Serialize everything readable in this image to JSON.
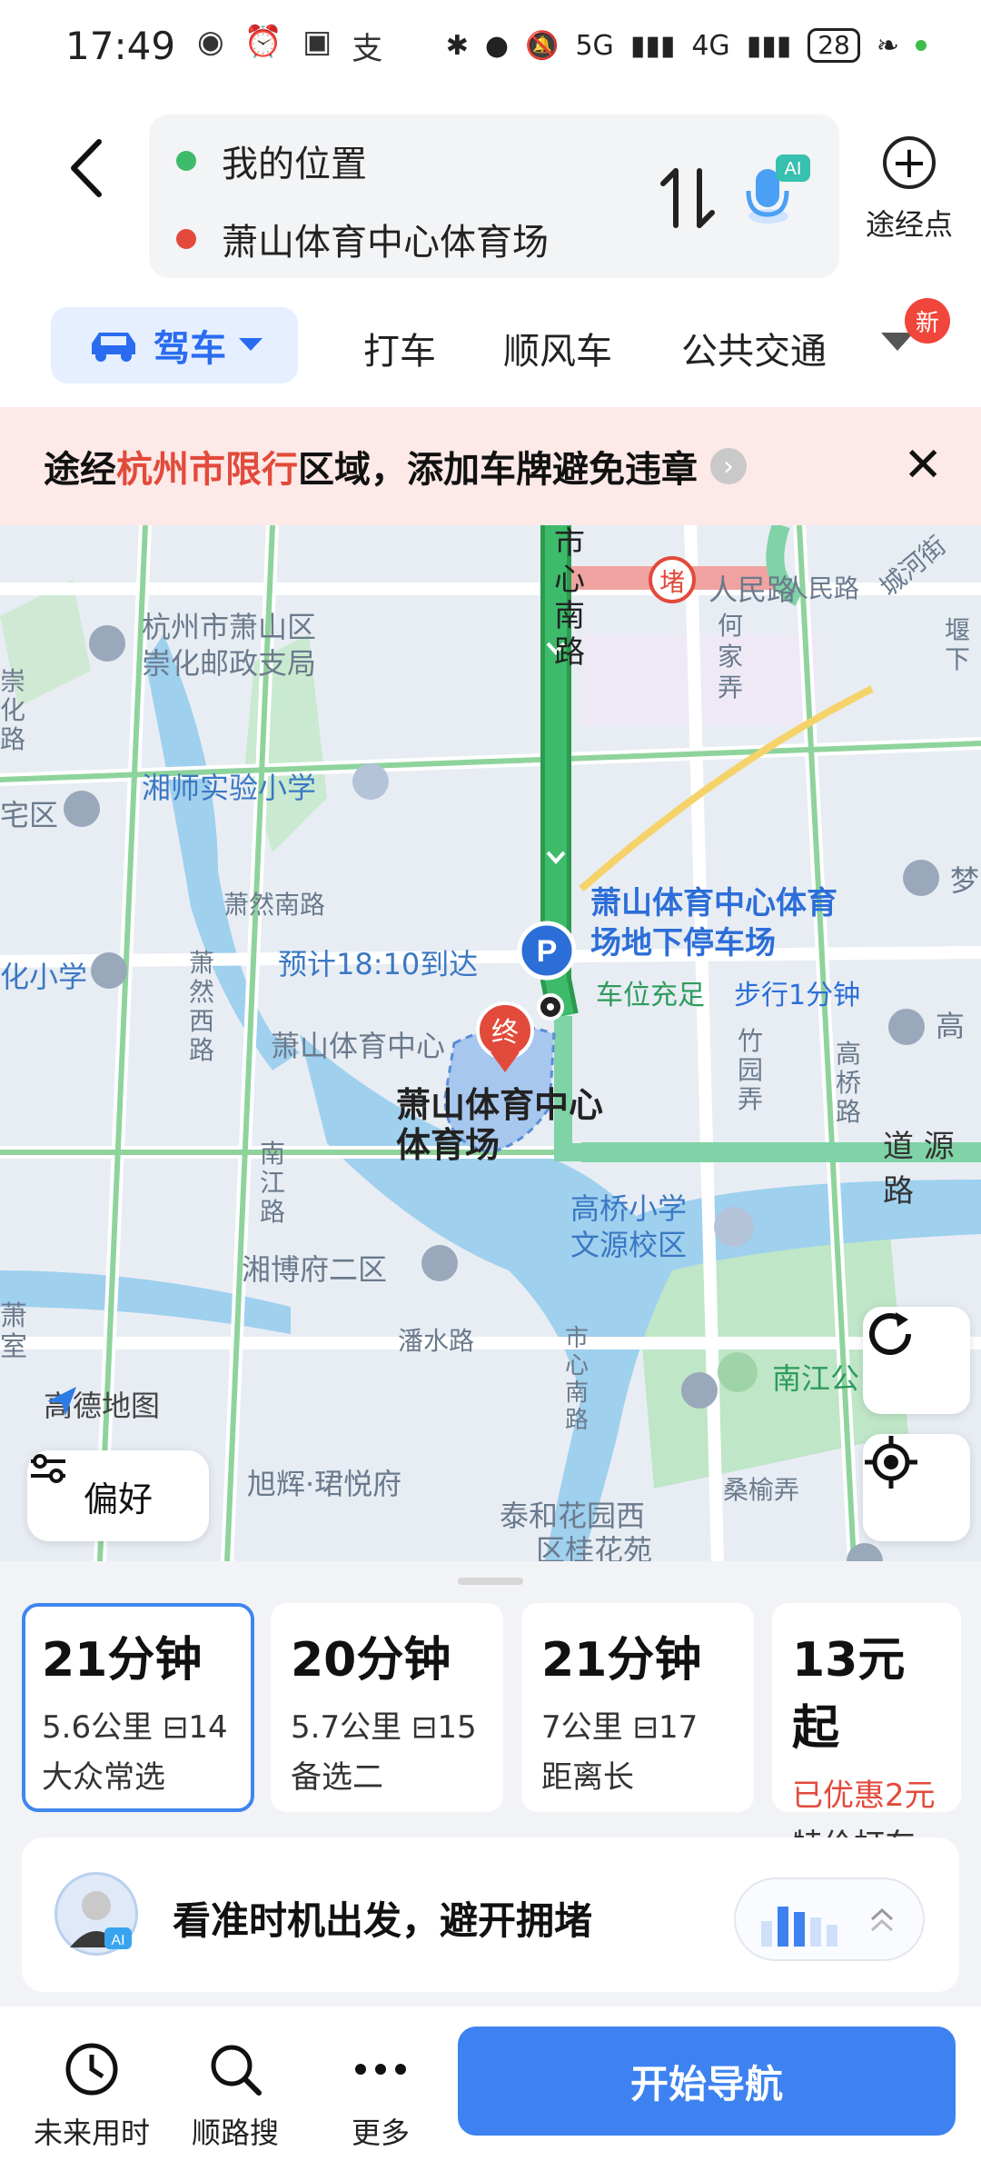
{
  "status": {
    "time": "17:49",
    "network1": "5G",
    "network2": "4G",
    "battery": "28"
  },
  "route": {
    "origin": "我的位置",
    "destination": "萧山体育中心体育场",
    "ai_badge": "AI",
    "waypoint_label": "途经点"
  },
  "modes": {
    "active": "驾车",
    "taxi": "打车",
    "carpool": "顺风车",
    "transit": "公共交通",
    "new_badge": "新"
  },
  "banner": {
    "prefix": "途经",
    "highlight": "杭州市限行",
    "suffix": "区域，添加车牌避免违章"
  },
  "map": {
    "labels": {
      "post_office_1": "杭州市萧山区",
      "post_office_2": "崇化邮政支局",
      "school1": "湘师实验小学",
      "road_xiaoran": "萧然南路",
      "road_xiaoran_w": "萧然西路",
      "road_shixin": "市心南路",
      "road_shixin2": "市心南路",
      "road_renmin": "人民路",
      "road_renmin2": "人民路",
      "road_hejia": "何家弄",
      "road_chenghe": "城河街",
      "road_zhuyuan": "竹园弄",
      "road_gaoqiao": "高桥路",
      "road_daoyuan": "道 源 路",
      "road_nanjiang": "南江路",
      "road_panshui": "潘水路",
      "road_sangyu": "桑榆弄",
      "sports_center": "萧山体育中心",
      "xiangbo": "湘博府二区",
      "gaoqiao_school_1": "高桥小学",
      "gaoqiao_school_2": "文源校区",
      "nanjiang_park": "南江公",
      "xuhui": "旭辉·珺悦府",
      "taihe_1": "泰和花园西",
      "taihe_2": "区桂花苑",
      "left_school": "化小学",
      "left_qu": "宅区",
      "gao_right": "高",
      "meng_right": "梦",
      "chonghua_left": "崇化路",
      "xiao_left": "萧室",
      "lou_right": "堰下",
      "jam": "堵",
      "end_pin": "终",
      "parking": "P"
    },
    "parking_name_1": "萧山体育中心体育",
    "parking_name_2": "场地下停车场",
    "parking_status": "车位充足",
    "parking_walk": "步行1分钟",
    "eta": "预计18:10到达",
    "dest_name_1": "萧山体育中心",
    "dest_name_2": "体育场",
    "logo_text": "高德地图",
    "pref_label": "偏好"
  },
  "routes": [
    {
      "time": "21分钟",
      "distance": "5.6公里",
      "lights": "14",
      "tag": "大众常选"
    },
    {
      "time": "20分钟",
      "distance": "5.7公里",
      "lights": "15",
      "tag": "备选二"
    },
    {
      "time": "21分钟",
      "distance": "7公里",
      "lights": "17",
      "tag": "距离长"
    },
    {
      "time": "13元起",
      "distance": "已优惠2元",
      "lights": "",
      "tag": "特价打车"
    }
  ],
  "ai_tip": {
    "text": "看准时机出发，避开拥堵",
    "avatar_badge": "AI"
  },
  "bottom": {
    "future": "未来用时",
    "along_search": "顺路搜",
    "more": "更多",
    "start_nav": "开始导航"
  },
  "colors": {
    "accent": "#3d82f0",
    "route_green": "#3dbb6b",
    "restrict_red": "#e24a3b"
  }
}
